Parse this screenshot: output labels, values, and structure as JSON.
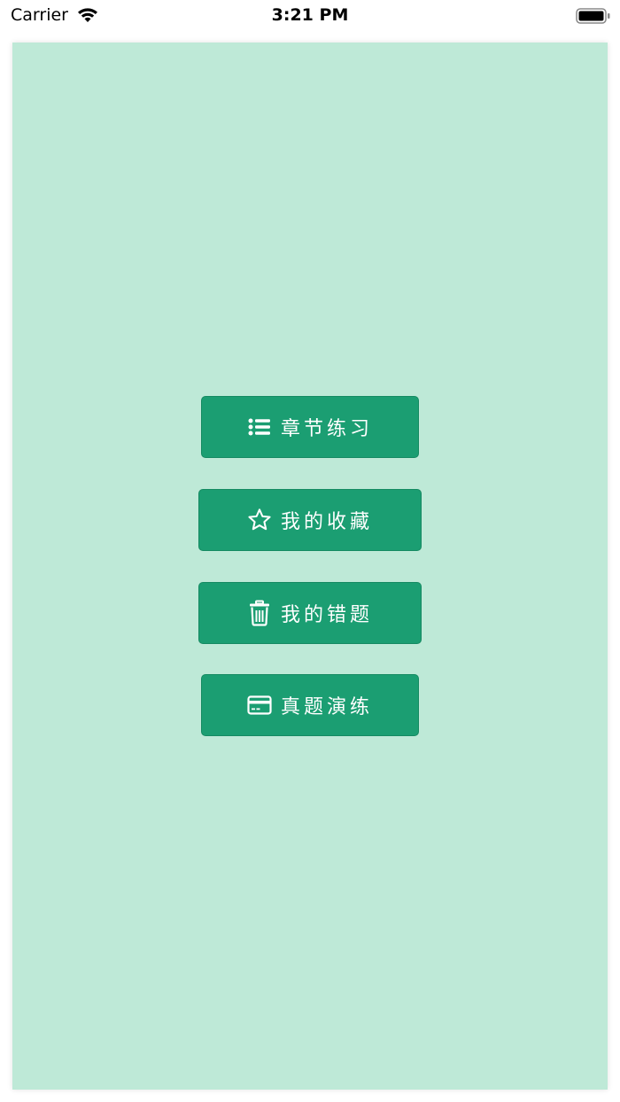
{
  "status_bar": {
    "carrier": "Carrier",
    "time": "3:21 PM"
  },
  "colors": {
    "panel_bg": "#bee9d7",
    "button_bg": "#1b9e72",
    "button_text": "#ffffff"
  },
  "menu": {
    "items": [
      {
        "label": "章节练习",
        "icon": "list-icon"
      },
      {
        "label": "我的收藏",
        "icon": "star-icon"
      },
      {
        "label": "我的错题",
        "icon": "trash-icon"
      },
      {
        "label": "真题演练",
        "icon": "card-icon"
      }
    ]
  }
}
